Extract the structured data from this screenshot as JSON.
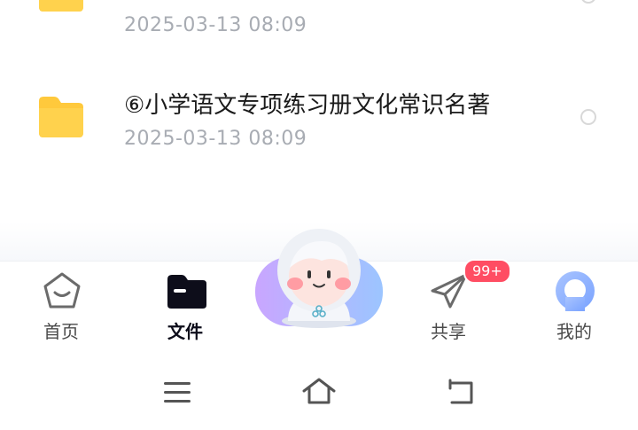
{
  "files": [
    {
      "name": "",
      "date": "2025-03-13  08:09"
    },
    {
      "name": "⑥小学语文专项练习册文化常识名著",
      "date": "2025-03-13  08:09"
    }
  ],
  "tabbar": {
    "home_label": "首页",
    "files_label": "文件",
    "share_label": "共享",
    "share_badge": "99+",
    "mine_label": "我的"
  },
  "colors": {
    "folder": "#ffc93c",
    "badge": "#ff4d63",
    "active_tab": "#0d0d1a",
    "date_text": "#a8acb3"
  },
  "icons": [
    "folder-icon",
    "home-icon",
    "files-icon",
    "assistant-mascot-icon",
    "share-send-icon",
    "avatar-icon",
    "menu-icon",
    "home-nav-icon",
    "back-icon"
  ]
}
